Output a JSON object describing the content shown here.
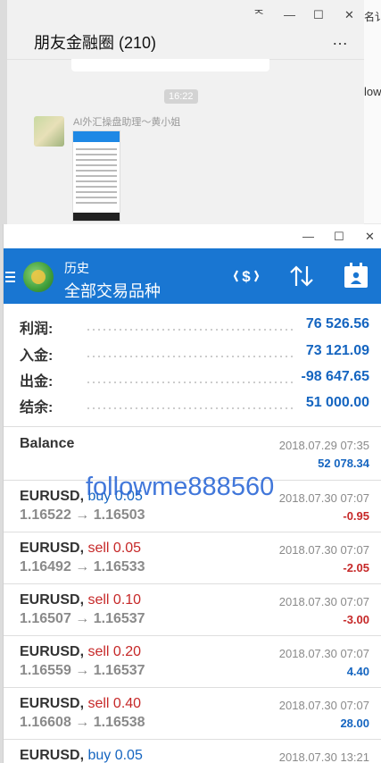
{
  "chat_window": {
    "title": "朋友金融圈 (210)",
    "more": "…",
    "controls": {
      "pin": "ᅐ",
      "minimize": "—",
      "maximize": "☐",
      "close": "✕"
    },
    "time_divider": "16:22",
    "sender": "AI外汇操盘助理～黄小姐",
    "right_edge_text_1": "名讠",
    "right_edge_text_2": "low"
  },
  "app_window": {
    "controls": {
      "minimize": "—",
      "maximize": "☐",
      "close": "✕"
    },
    "toolbar": {
      "subtitle": "历史",
      "title": "全部交易品种",
      "icons": [
        "currency-exchange-icon",
        "sort-icon",
        "calendar-icon"
      ]
    },
    "summary": [
      {
        "label": "利润:",
        "value": "76 526.56"
      },
      {
        "label": "入金:",
        "value": "73 121.09"
      },
      {
        "label": "出金:",
        "value": "-98 647.65"
      },
      {
        "label": "结余:",
        "value": "51 000.00"
      }
    ],
    "trades": [
      {
        "symbol": "Balance",
        "side": "",
        "side_type": "",
        "price": "",
        "date": "2018.07.29 07:35",
        "profit": "52 078.34",
        "profit_sign": "pos"
      },
      {
        "symbol": "EURUSD,",
        "side": "buy 0.05",
        "side_type": "buy",
        "price": "1.16522 → 1.16503",
        "date": "2018.07.30 07:07",
        "profit": "-0.95",
        "profit_sign": "neg"
      },
      {
        "symbol": "EURUSD,",
        "side": "sell 0.05",
        "side_type": "sell",
        "price": "1.16492 → 1.16533",
        "date": "2018.07.30 07:07",
        "profit": "-2.05",
        "profit_sign": "neg"
      },
      {
        "symbol": "EURUSD,",
        "side": "sell 0.10",
        "side_type": "sell",
        "price": "1.16507 → 1.16537",
        "date": "2018.07.30 07:07",
        "profit": "-3.00",
        "profit_sign": "neg"
      },
      {
        "symbol": "EURUSD,",
        "side": "sell 0.20",
        "side_type": "sell",
        "price": "1.16559 → 1.16537",
        "date": "2018.07.30 07:07",
        "profit": "4.40",
        "profit_sign": "pos"
      },
      {
        "symbol": "EURUSD,",
        "side": "sell 0.40",
        "side_type": "sell",
        "price": "1.16608 → 1.16538",
        "date": "2018.07.30 07:07",
        "profit": "28.00",
        "profit_sign": "pos"
      },
      {
        "symbol": "EURUSD,",
        "side": "buy 0.05",
        "side_type": "buy",
        "price": "",
        "date": "2018.07.30 13:21",
        "profit": "",
        "profit_sign": ""
      }
    ],
    "watermark": "followme888560"
  },
  "colors": {
    "toolbar": "#1976d2",
    "positive": "#1565c0",
    "negative": "#c62828",
    "muted": "#8a8a8a"
  }
}
